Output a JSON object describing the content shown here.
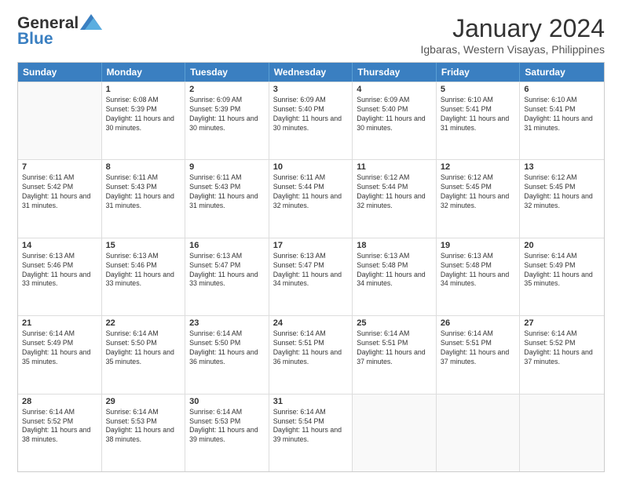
{
  "header": {
    "logo_line1": "General",
    "logo_line2": "Blue",
    "main_title": "January 2024",
    "subtitle": "Igbaras, Western Visayas, Philippines"
  },
  "days": [
    "Sunday",
    "Monday",
    "Tuesday",
    "Wednesday",
    "Thursday",
    "Friday",
    "Saturday"
  ],
  "weeks": [
    [
      {
        "num": "",
        "sunrise": "",
        "sunset": "",
        "daylight": "",
        "empty": true
      },
      {
        "num": "1",
        "sunrise": "Sunrise: 6:08 AM",
        "sunset": "Sunset: 5:39 PM",
        "daylight": "Daylight: 11 hours and 30 minutes.",
        "empty": false
      },
      {
        "num": "2",
        "sunrise": "Sunrise: 6:09 AM",
        "sunset": "Sunset: 5:39 PM",
        "daylight": "Daylight: 11 hours and 30 minutes.",
        "empty": false
      },
      {
        "num": "3",
        "sunrise": "Sunrise: 6:09 AM",
        "sunset": "Sunset: 5:40 PM",
        "daylight": "Daylight: 11 hours and 30 minutes.",
        "empty": false
      },
      {
        "num": "4",
        "sunrise": "Sunrise: 6:09 AM",
        "sunset": "Sunset: 5:40 PM",
        "daylight": "Daylight: 11 hours and 30 minutes.",
        "empty": false
      },
      {
        "num": "5",
        "sunrise": "Sunrise: 6:10 AM",
        "sunset": "Sunset: 5:41 PM",
        "daylight": "Daylight: 11 hours and 31 minutes.",
        "empty": false
      },
      {
        "num": "6",
        "sunrise": "Sunrise: 6:10 AM",
        "sunset": "Sunset: 5:41 PM",
        "daylight": "Daylight: 11 hours and 31 minutes.",
        "empty": false
      }
    ],
    [
      {
        "num": "7",
        "sunrise": "Sunrise: 6:11 AM",
        "sunset": "Sunset: 5:42 PM",
        "daylight": "Daylight: 11 hours and 31 minutes.",
        "empty": false
      },
      {
        "num": "8",
        "sunrise": "Sunrise: 6:11 AM",
        "sunset": "Sunset: 5:43 PM",
        "daylight": "Daylight: 11 hours and 31 minutes.",
        "empty": false
      },
      {
        "num": "9",
        "sunrise": "Sunrise: 6:11 AM",
        "sunset": "Sunset: 5:43 PM",
        "daylight": "Daylight: 11 hours and 31 minutes.",
        "empty": false
      },
      {
        "num": "10",
        "sunrise": "Sunrise: 6:11 AM",
        "sunset": "Sunset: 5:44 PM",
        "daylight": "Daylight: 11 hours and 32 minutes.",
        "empty": false
      },
      {
        "num": "11",
        "sunrise": "Sunrise: 6:12 AM",
        "sunset": "Sunset: 5:44 PM",
        "daylight": "Daylight: 11 hours and 32 minutes.",
        "empty": false
      },
      {
        "num": "12",
        "sunrise": "Sunrise: 6:12 AM",
        "sunset": "Sunset: 5:45 PM",
        "daylight": "Daylight: 11 hours and 32 minutes.",
        "empty": false
      },
      {
        "num": "13",
        "sunrise": "Sunrise: 6:12 AM",
        "sunset": "Sunset: 5:45 PM",
        "daylight": "Daylight: 11 hours and 32 minutes.",
        "empty": false
      }
    ],
    [
      {
        "num": "14",
        "sunrise": "Sunrise: 6:13 AM",
        "sunset": "Sunset: 5:46 PM",
        "daylight": "Daylight: 11 hours and 33 minutes.",
        "empty": false
      },
      {
        "num": "15",
        "sunrise": "Sunrise: 6:13 AM",
        "sunset": "Sunset: 5:46 PM",
        "daylight": "Daylight: 11 hours and 33 minutes.",
        "empty": false
      },
      {
        "num": "16",
        "sunrise": "Sunrise: 6:13 AM",
        "sunset": "Sunset: 5:47 PM",
        "daylight": "Daylight: 11 hours and 33 minutes.",
        "empty": false
      },
      {
        "num": "17",
        "sunrise": "Sunrise: 6:13 AM",
        "sunset": "Sunset: 5:47 PM",
        "daylight": "Daylight: 11 hours and 34 minutes.",
        "empty": false
      },
      {
        "num": "18",
        "sunrise": "Sunrise: 6:13 AM",
        "sunset": "Sunset: 5:48 PM",
        "daylight": "Daylight: 11 hours and 34 minutes.",
        "empty": false
      },
      {
        "num": "19",
        "sunrise": "Sunrise: 6:13 AM",
        "sunset": "Sunset: 5:48 PM",
        "daylight": "Daylight: 11 hours and 34 minutes.",
        "empty": false
      },
      {
        "num": "20",
        "sunrise": "Sunrise: 6:14 AM",
        "sunset": "Sunset: 5:49 PM",
        "daylight": "Daylight: 11 hours and 35 minutes.",
        "empty": false
      }
    ],
    [
      {
        "num": "21",
        "sunrise": "Sunrise: 6:14 AM",
        "sunset": "Sunset: 5:49 PM",
        "daylight": "Daylight: 11 hours and 35 minutes.",
        "empty": false
      },
      {
        "num": "22",
        "sunrise": "Sunrise: 6:14 AM",
        "sunset": "Sunset: 5:50 PM",
        "daylight": "Daylight: 11 hours and 35 minutes.",
        "empty": false
      },
      {
        "num": "23",
        "sunrise": "Sunrise: 6:14 AM",
        "sunset": "Sunset: 5:50 PM",
        "daylight": "Daylight: 11 hours and 36 minutes.",
        "empty": false
      },
      {
        "num": "24",
        "sunrise": "Sunrise: 6:14 AM",
        "sunset": "Sunset: 5:51 PM",
        "daylight": "Daylight: 11 hours and 36 minutes.",
        "empty": false
      },
      {
        "num": "25",
        "sunrise": "Sunrise: 6:14 AM",
        "sunset": "Sunset: 5:51 PM",
        "daylight": "Daylight: 11 hours and 37 minutes.",
        "empty": false
      },
      {
        "num": "26",
        "sunrise": "Sunrise: 6:14 AM",
        "sunset": "Sunset: 5:51 PM",
        "daylight": "Daylight: 11 hours and 37 minutes.",
        "empty": false
      },
      {
        "num": "27",
        "sunrise": "Sunrise: 6:14 AM",
        "sunset": "Sunset: 5:52 PM",
        "daylight": "Daylight: 11 hours and 37 minutes.",
        "empty": false
      }
    ],
    [
      {
        "num": "28",
        "sunrise": "Sunrise: 6:14 AM",
        "sunset": "Sunset: 5:52 PM",
        "daylight": "Daylight: 11 hours and 38 minutes.",
        "empty": false
      },
      {
        "num": "29",
        "sunrise": "Sunrise: 6:14 AM",
        "sunset": "Sunset: 5:53 PM",
        "daylight": "Daylight: 11 hours and 38 minutes.",
        "empty": false
      },
      {
        "num": "30",
        "sunrise": "Sunrise: 6:14 AM",
        "sunset": "Sunset: 5:53 PM",
        "daylight": "Daylight: 11 hours and 39 minutes.",
        "empty": false
      },
      {
        "num": "31",
        "sunrise": "Sunrise: 6:14 AM",
        "sunset": "Sunset: 5:54 PM",
        "daylight": "Daylight: 11 hours and 39 minutes.",
        "empty": false
      },
      {
        "num": "",
        "sunrise": "",
        "sunset": "",
        "daylight": "",
        "empty": true
      },
      {
        "num": "",
        "sunrise": "",
        "sunset": "",
        "daylight": "",
        "empty": true
      },
      {
        "num": "",
        "sunrise": "",
        "sunset": "",
        "daylight": "",
        "empty": true
      }
    ]
  ]
}
